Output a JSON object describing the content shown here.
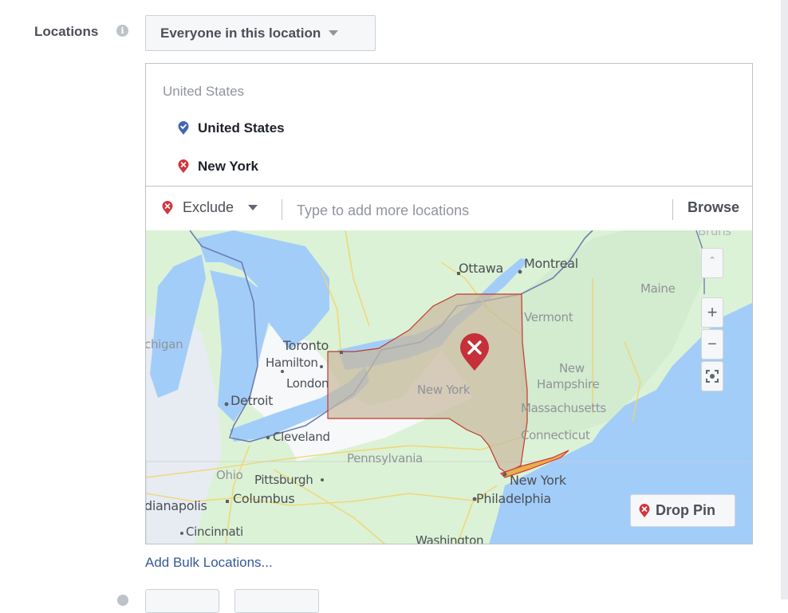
{
  "locations": {
    "label": "Locations",
    "info_icon": "info-icon",
    "audience_select": {
      "selected": "Everyone in this location"
    },
    "group_title": "United States",
    "items": [
      {
        "name": "United States",
        "mode": "include",
        "icon": "include-pin-icon",
        "color": "#4267b2"
      },
      {
        "name": "New York",
        "mode": "exclude",
        "icon": "exclude-pin-icon",
        "color": "#d0373d"
      }
    ],
    "search": {
      "mode_selected": "Exclude",
      "placeholder": "Type to add more locations",
      "value": "",
      "browse_label": "Browse"
    }
  },
  "map": {
    "labels": {
      "ottawa": "Ottawa",
      "montreal": "Montreal",
      "maine": "Maine",
      "vermont": "Vermont",
      "michigan": "chigan",
      "toronto": "Toronto",
      "hamilton": "Hamilton",
      "london": "London",
      "detroit": "Detroit",
      "new_york_state": "New York",
      "new_hampshire_1": "New",
      "new_hampshire_2": "Hampshire",
      "massachusetts": "Massachusetts",
      "connecticut": "Connecticut",
      "cleveland": "Cleveland",
      "pennsylvania": "Pennsylvania",
      "ohio": "Ohio",
      "pittsburgh": "Pittsburgh",
      "columbus": "Columbus",
      "indianapolis": "dianapolis",
      "new_york_city": "New York",
      "philadelphia": "Philadelphia",
      "cincinnati": "Cincinnati",
      "washington": "Washington",
      "brunswick": "Bruns"
    },
    "controls": {
      "zoom_in": "+",
      "zoom_out": "−",
      "collapse": "ˆ",
      "drop_pin_label": "Drop Pin"
    },
    "excluded_region": "New York",
    "colors": {
      "water": "#a3cdf9",
      "land": "#dcf2d6",
      "excluded_fill": "#c9b8a0",
      "excluded_border": "#c0392b",
      "pin": "#c6303a"
    }
  },
  "bulk_link": "Add Bulk Locations..."
}
